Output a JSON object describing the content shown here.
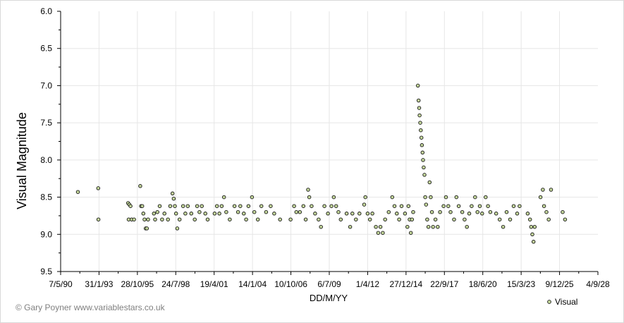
{
  "copyright": "© Gary Poyner  www.variablestars.co.uk",
  "chart_data": {
    "type": "scatter",
    "ylabel": "Visual Magnitude",
    "xlabel": "DD/M/YY",
    "y_inverted": true,
    "ylim": [
      6.0,
      9.5
    ],
    "y_ticks": [
      "6.0",
      "6.5",
      "7.0",
      "7.5",
      "8.0",
      "8.5",
      "9.0",
      "9.5"
    ],
    "xlim": [
      "1990-05-07",
      "2028-09-04"
    ],
    "x_ticks": [
      "7/5/90",
      "31/1/93",
      "28/10/95",
      "24/7/98",
      "19/4/01",
      "14/1/04",
      "10/10/06",
      "6/7/09",
      "1/4/12",
      "27/12/14",
      "22/9/17",
      "18/6/20",
      "15/3/23",
      "9/12/25",
      "4/9/28"
    ],
    "legend": {
      "position": "bottom-right",
      "entries": [
        "Visual"
      ]
    },
    "colors": {
      "marker_fill": "#c4d79b",
      "marker_stroke": "#1a1a1a",
      "axis": "#000000"
    },
    "series": [
      {
        "name": "Visual",
        "points": [
          [
            "1991-08-01",
            8.43
          ],
          [
            "1993-01-10",
            8.38
          ],
          [
            "1993-01-15",
            8.8
          ],
          [
            "1995-03-01",
            8.58
          ],
          [
            "1995-04-01",
            8.6
          ],
          [
            "1995-05-01",
            8.62
          ],
          [
            "1995-03-15",
            8.8
          ],
          [
            "1995-06-01",
            8.8
          ],
          [
            "1995-08-01",
            8.8
          ],
          [
            "1996-01-10",
            8.35
          ],
          [
            "1996-02-01",
            8.62
          ],
          [
            "1996-03-01",
            8.62
          ],
          [
            "1996-04-01",
            8.72
          ],
          [
            "1996-05-01",
            8.8
          ],
          [
            "1996-06-01",
            8.92
          ],
          [
            "1996-07-01",
            8.92
          ],
          [
            "1996-08-01",
            8.8
          ],
          [
            "1997-01-01",
            8.72
          ],
          [
            "1997-02-01",
            8.8
          ],
          [
            "1997-04-01",
            8.7
          ],
          [
            "1997-06-01",
            8.62
          ],
          [
            "1997-08-01",
            8.8
          ],
          [
            "1997-10-01",
            8.72
          ],
          [
            "1998-01-01",
            8.8
          ],
          [
            "1998-03-01",
            8.62
          ],
          [
            "1998-05-01",
            8.45
          ],
          [
            "1998-06-01",
            8.52
          ],
          [
            "1998-07-01",
            8.62
          ],
          [
            "1998-08-01",
            8.72
          ],
          [
            "1998-09-01",
            8.92
          ],
          [
            "1998-11-01",
            8.8
          ],
          [
            "1999-02-01",
            8.62
          ],
          [
            "1999-04-01",
            8.72
          ],
          [
            "1999-06-01",
            8.62
          ],
          [
            "1999-09-01",
            8.72
          ],
          [
            "1999-12-01",
            8.8
          ],
          [
            "2000-02-01",
            8.62
          ],
          [
            "2000-04-01",
            8.7
          ],
          [
            "2000-06-01",
            8.62
          ],
          [
            "2000-09-01",
            8.72
          ],
          [
            "2000-11-01",
            8.8
          ],
          [
            "2001-05-01",
            8.72
          ],
          [
            "2001-07-01",
            8.62
          ],
          [
            "2001-09-01",
            8.72
          ],
          [
            "2001-11-01",
            8.62
          ],
          [
            "2002-01-01",
            8.5
          ],
          [
            "2002-03-01",
            8.7
          ],
          [
            "2002-06-01",
            8.8
          ],
          [
            "2002-10-01",
            8.62
          ],
          [
            "2003-01-01",
            8.7
          ],
          [
            "2003-03-01",
            8.62
          ],
          [
            "2003-06-01",
            8.72
          ],
          [
            "2003-08-01",
            8.8
          ],
          [
            "2003-10-01",
            8.62
          ],
          [
            "2004-01-01",
            8.5
          ],
          [
            "2004-03-01",
            8.7
          ],
          [
            "2004-06-01",
            8.8
          ],
          [
            "2004-09-01",
            8.62
          ],
          [
            "2005-01-01",
            8.7
          ],
          [
            "2005-05-01",
            8.62
          ],
          [
            "2005-08-01",
            8.72
          ],
          [
            "2006-01-01",
            8.8
          ],
          [
            "2006-10-01",
            8.8
          ],
          [
            "2007-01-01",
            8.62
          ],
          [
            "2007-03-01",
            8.7
          ],
          [
            "2007-06-01",
            8.7
          ],
          [
            "2007-09-01",
            8.62
          ],
          [
            "2007-11-01",
            8.8
          ],
          [
            "2008-01-01",
            8.4
          ],
          [
            "2008-02-01",
            8.5
          ],
          [
            "2008-04-01",
            8.62
          ],
          [
            "2008-07-01",
            8.72
          ],
          [
            "2008-10-01",
            8.8
          ],
          [
            "2008-12-01",
            8.9
          ],
          [
            "2009-03-01",
            8.62
          ],
          [
            "2009-06-01",
            8.72
          ],
          [
            "2009-09-01",
            8.62
          ],
          [
            "2009-11-01",
            8.5
          ],
          [
            "2010-01-01",
            8.62
          ],
          [
            "2010-03-01",
            8.7
          ],
          [
            "2010-05-01",
            8.8
          ],
          [
            "2010-10-01",
            8.72
          ],
          [
            "2011-01-01",
            8.9
          ],
          [
            "2011-03-01",
            8.72
          ],
          [
            "2011-06-01",
            8.8
          ],
          [
            "2011-09-01",
            8.72
          ],
          [
            "2012-01-01",
            8.6
          ],
          [
            "2012-02-01",
            8.5
          ],
          [
            "2012-04-01",
            8.72
          ],
          [
            "2012-06-01",
            8.8
          ],
          [
            "2012-08-01",
            8.72
          ],
          [
            "2012-11-01",
            8.9
          ],
          [
            "2013-01-01",
            8.98
          ],
          [
            "2013-03-01",
            8.9
          ],
          [
            "2013-05-01",
            8.98
          ],
          [
            "2013-07-01",
            8.8
          ],
          [
            "2013-10-01",
            8.7
          ],
          [
            "2014-01-01",
            8.5
          ],
          [
            "2014-03-01",
            8.62
          ],
          [
            "2014-05-01",
            8.72
          ],
          [
            "2014-07-01",
            8.8
          ],
          [
            "2014-09-01",
            8.62
          ],
          [
            "2014-12-01",
            8.72
          ],
          [
            "2015-02-01",
            8.9
          ],
          [
            "2015-03-01",
            8.62
          ],
          [
            "2015-04-01",
            8.8
          ],
          [
            "2015-05-01",
            8.98
          ],
          [
            "2015-06-01",
            8.8
          ],
          [
            "2015-07-01",
            8.7
          ],
          [
            "2015-11-01",
            7.0
          ],
          [
            "2015-11-20",
            7.2
          ],
          [
            "2015-12-05",
            7.3
          ],
          [
            "2015-12-15",
            7.4
          ],
          [
            "2016-01-01",
            7.5
          ],
          [
            "2016-01-15",
            7.6
          ],
          [
            "2016-02-01",
            7.7
          ],
          [
            "2016-02-15",
            7.8
          ],
          [
            "2016-03-01",
            7.9
          ],
          [
            "2016-03-15",
            8.0
          ],
          [
            "2016-04-01",
            8.1
          ],
          [
            "2016-04-20",
            8.2
          ],
          [
            "2016-05-10",
            8.5
          ],
          [
            "2016-06-01",
            8.6
          ],
          [
            "2016-07-01",
            8.8
          ],
          [
            "2016-08-01",
            8.9
          ],
          [
            "2016-09-01",
            8.3
          ],
          [
            "2016-10-01",
            8.5
          ],
          [
            "2016-11-01",
            8.7
          ],
          [
            "2016-12-01",
            8.9
          ],
          [
            "2017-02-01",
            8.8
          ],
          [
            "2017-04-01",
            8.9
          ],
          [
            "2017-06-01",
            8.7
          ],
          [
            "2017-09-01",
            8.62
          ],
          [
            "2017-11-01",
            8.5
          ],
          [
            "2018-01-01",
            8.62
          ],
          [
            "2018-03-01",
            8.7
          ],
          [
            "2018-06-01",
            8.8
          ],
          [
            "2018-08-01",
            8.5
          ],
          [
            "2018-10-01",
            8.62
          ],
          [
            "2019-01-01",
            8.7
          ],
          [
            "2019-03-01",
            8.8
          ],
          [
            "2019-05-01",
            8.9
          ],
          [
            "2019-07-01",
            8.72
          ],
          [
            "2019-09-01",
            8.62
          ],
          [
            "2019-12-01",
            8.5
          ],
          [
            "2020-02-01",
            8.7
          ],
          [
            "2020-04-01",
            8.62
          ],
          [
            "2020-06-01",
            8.72
          ],
          [
            "2020-09-01",
            8.5
          ],
          [
            "2020-11-01",
            8.62
          ],
          [
            "2021-01-01",
            8.7
          ],
          [
            "2021-06-01",
            8.72
          ],
          [
            "2021-09-01",
            8.8
          ],
          [
            "2021-12-01",
            8.9
          ],
          [
            "2022-03-01",
            8.7
          ],
          [
            "2022-06-01",
            8.8
          ],
          [
            "2022-09-01",
            8.62
          ],
          [
            "2022-12-01",
            8.72
          ],
          [
            "2023-02-01",
            8.62
          ],
          [
            "2023-09-01",
            8.72
          ],
          [
            "2023-11-01",
            8.8
          ],
          [
            "2023-12-01",
            8.9
          ],
          [
            "2024-01-01",
            9.0
          ],
          [
            "2024-02-01",
            9.1
          ],
          [
            "2024-03-01",
            8.9
          ],
          [
            "2024-08-01",
            8.5
          ],
          [
            "2024-10-01",
            8.4
          ],
          [
            "2024-11-01",
            8.62
          ],
          [
            "2025-01-01",
            8.7
          ],
          [
            "2025-03-01",
            8.8
          ],
          [
            "2025-05-01",
            8.4
          ],
          [
            "2026-03-01",
            8.7
          ],
          [
            "2026-05-01",
            8.8
          ]
        ]
      }
    ]
  }
}
